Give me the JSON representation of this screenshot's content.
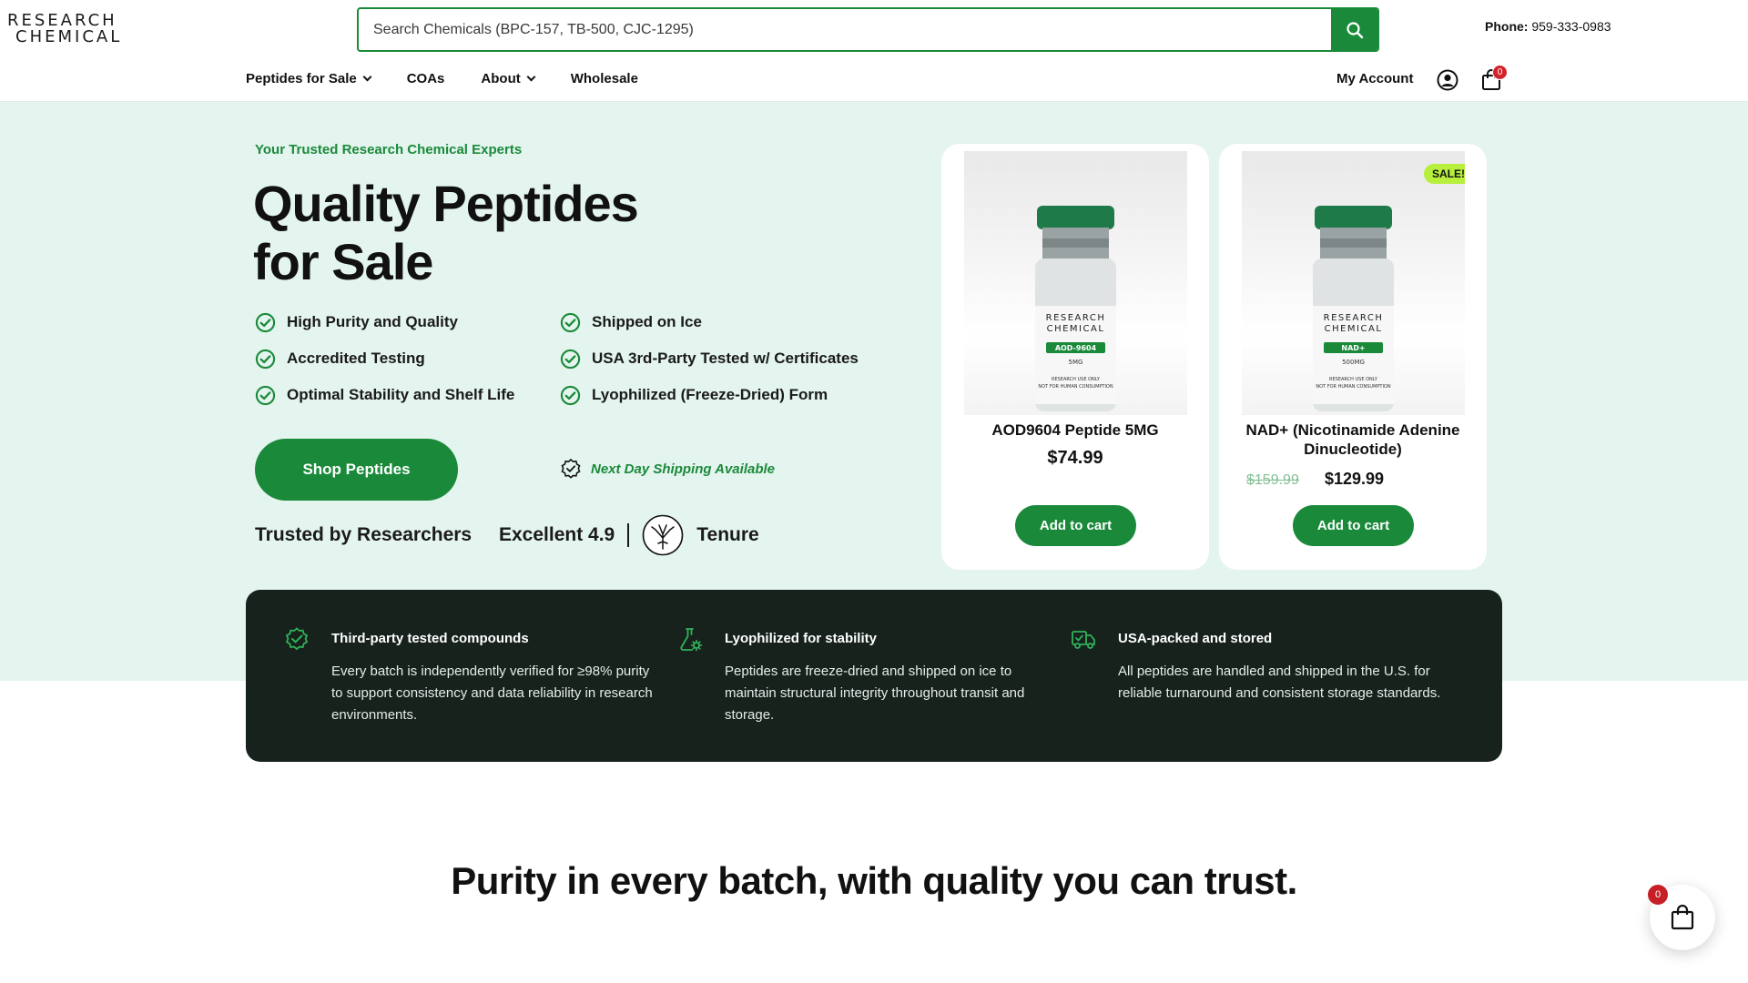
{
  "brand": {
    "logo_line1": "RESEARCH",
    "logo_line2": "CHEMICAL",
    "accent": "#1a8a3a"
  },
  "header": {
    "search_placeholder": "Search Chemicals (BPC-157, TB-500, CJC-1295)",
    "phone_label": "Phone:",
    "phone_number": "959-333-0983",
    "nav": [
      {
        "label": "Peptides for Sale",
        "has_dropdown": true
      },
      {
        "label": "COAs",
        "has_dropdown": false
      },
      {
        "label": "About",
        "has_dropdown": true
      },
      {
        "label": "Wholesale",
        "has_dropdown": false
      }
    ],
    "account_label": "My Account",
    "cart_count": "0"
  },
  "hero": {
    "eyebrow": "Your Trusted Research Chemical Experts",
    "title_line1": "Quality Peptides",
    "title_line2": "for Sale",
    "features": [
      "High Purity and Quality",
      "Shipped on Ice",
      "Accredited Testing",
      "USA 3rd-Party Tested w/ Certificates",
      "Optimal Stability and Shelf Life",
      "Lyophilized (Freeze-Dried) Form"
    ],
    "cta_label": "Shop Peptides",
    "shipping_note": "Next Day Shipping Available",
    "trusted_label": "Trusted by Researchers",
    "rating_label": "Excellent 4.9",
    "rating_brand": "Tenure"
  },
  "products": [
    {
      "name": "AOD9604 Peptide 5MG",
      "price": "$74.99",
      "vial_label": "AOD-9604",
      "vial_dose": "5MG",
      "vial_brand_1": "RESEARCH",
      "vial_brand_2": "CHEMICAL",
      "vial_note_1": "RESEARCH USE ONLY",
      "vial_note_2": "NOT FOR HUMAN CONSUMPTION",
      "button": "Add to cart"
    },
    {
      "name": "NAD+ (Nicotinamide Adenine Dinucleotide)",
      "old_price": "$159.99",
      "price": "$129.99",
      "sale_badge": "SALE!",
      "vial_label": "NAD+",
      "vial_dose": "500MG",
      "vial_brand_1": "RESEARCH",
      "vial_brand_2": "CHEMICAL",
      "vial_note_1": "RESEARCH USE ONLY",
      "vial_note_2": "NOT FOR HUMAN CONSUMPTION",
      "button": "Add to cart"
    }
  ],
  "benefits": [
    {
      "icon": "verified-badge-icon",
      "title": "Third-party tested compounds",
      "text": "Every batch is independently verified for ≥98% purity to support consistency and data reliability in research environments."
    },
    {
      "icon": "flask-gear-icon",
      "title": "Lyophilized for stability",
      "text": "Peptides are freeze-dried and shipped on ice to maintain structural integrity throughout transit and storage."
    },
    {
      "icon": "delivery-truck-icon",
      "title": "USA-packed and stored",
      "text": "All peptides are handled and shipped in the U.S. for reliable turnaround and consistent storage standards."
    }
  ],
  "tagline": "Purity in every batch, with quality you can trust.",
  "floating_cart": {
    "count": "0"
  }
}
